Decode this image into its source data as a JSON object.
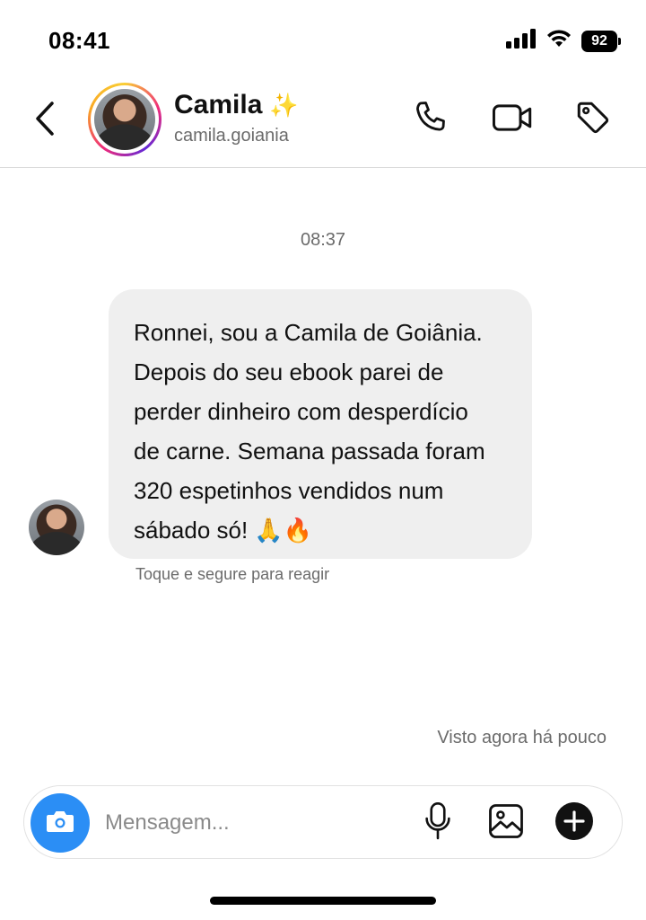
{
  "status_bar": {
    "time": "08:41",
    "battery": "92"
  },
  "header": {
    "contact_name": "Camila",
    "name_emoji": "✨",
    "handle": "camila.goiania",
    "icons": [
      "back-chevron-icon",
      "phone-icon",
      "video-camera-icon",
      "tag-icon"
    ]
  },
  "chat": {
    "timestamp": "08:37",
    "message": {
      "lines": [
        "Ronnei, sou a Camila de Goiânia.",
        "Depois do seu ebook parei de",
        "perder dinheiro com desperdício",
        "de carne. Semana passada foram",
        "320 espetinhos vendidos num",
        "sábado só! 🙏🔥"
      ]
    },
    "reaction_hint": "Toque e segure para reagir",
    "seen_status": "Visto agora há pouco"
  },
  "composer": {
    "placeholder": "Mensagem...",
    "icons": [
      "camera-icon",
      "microphone-icon",
      "image-icon",
      "plus-icon"
    ]
  },
  "colors": {
    "accent_blue": "#2b8ef5",
    "bubble_bg": "#efefef",
    "muted_text": "#6b6b6b"
  }
}
